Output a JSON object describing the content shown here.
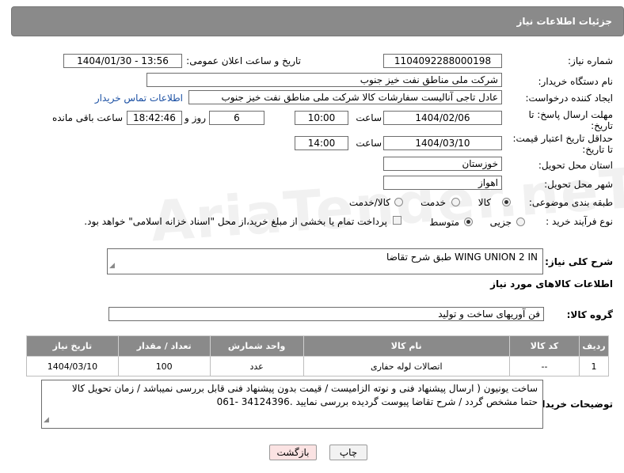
{
  "header": {
    "title": "جزئیات اطلاعات نیاز"
  },
  "watermark": "AriaTender.neT",
  "form": {
    "need_number_label": "شماره نیاز:",
    "need_number": "1104092288000198",
    "announce_label": "تاریخ و ساعت اعلان عمومی:",
    "announce_value": "1404/01/30 - 13:56",
    "buyer_label": "نام دستگاه خریدار:",
    "buyer_value": "شرکت ملی مناطق نفت خیز جنوب",
    "creator_label": "ایجاد کننده درخواست:",
    "creator_value": "عادل  تاجی آنالیست سفارشات کالا  شرکت ملی مناطق نفت خیز جنوب",
    "contact_link": "اطلاعات تماس خریدار",
    "deadline_label_1": "مهلت ارسال پاسخ: تا",
    "deadline_label_2": "تاریخ:",
    "deadline_date": "1404/02/06",
    "time_label": "ساعت",
    "deadline_time": "10:00",
    "days_value": "6",
    "days_label": "روز و",
    "remaining_time": "18:42:46",
    "remaining_label": "ساعت باقی مانده",
    "validity_label_1": "حداقل تاریخ اعتبار قیمت:",
    "validity_label_2": "تا تاریخ:",
    "validity_date": "1404/03/10",
    "validity_time": "14:00",
    "province_label": "استان محل تحویل:",
    "province_value": "خوزستان",
    "city_label": "شهر محل تحویل:",
    "city_value": "اهواز",
    "category_label": "طبقه بندی موضوعی:",
    "category_options": [
      "کالا",
      "خدمت",
      "کالا/خدمت"
    ],
    "process_label": "نوع فرآیند خرید :",
    "process_options": [
      "جزیی",
      "متوسط"
    ],
    "payment_note": "پرداخت تمام یا بخشی از مبلغ خرید،از محل \"اسناد خزانه اسلامی\" خواهد بود.",
    "summary_label": "شرح کلی نیاز:",
    "summary_value": "WING UNION  2 IN   طبق شرح تقاضا"
  },
  "goods": {
    "section_title": "اطلاعات کالاهای مورد نیاز",
    "group_label": "گروه کالا:",
    "group_value": "فن آوریهای ساخت و تولید",
    "columns": [
      "ردیف",
      "کد کالا",
      "نام کالا",
      "واحد شمارش",
      "تعداد / مقدار",
      "تاریخ نیاز"
    ],
    "rows": [
      [
        "1",
        "--",
        "اتصالات لوله حفاری",
        "عدد",
        "100",
        "1404/03/10"
      ]
    ]
  },
  "notes": {
    "label": "توضیحات خریدار:",
    "line1": "ساخت یونیون ( ارسال پیشنهاد فنی و نوته الزامیست / قیمت بدون پیشنهاد فنی قابل بررسی نمیباشد / زمان تحویل کالا",
    "line2": "حتما مشخص گردد / شرح تقاضا پیوست گردیده بررسی نمایید .34124396 -061"
  },
  "buttons": {
    "print": "چاپ",
    "back": "بازگشت"
  }
}
